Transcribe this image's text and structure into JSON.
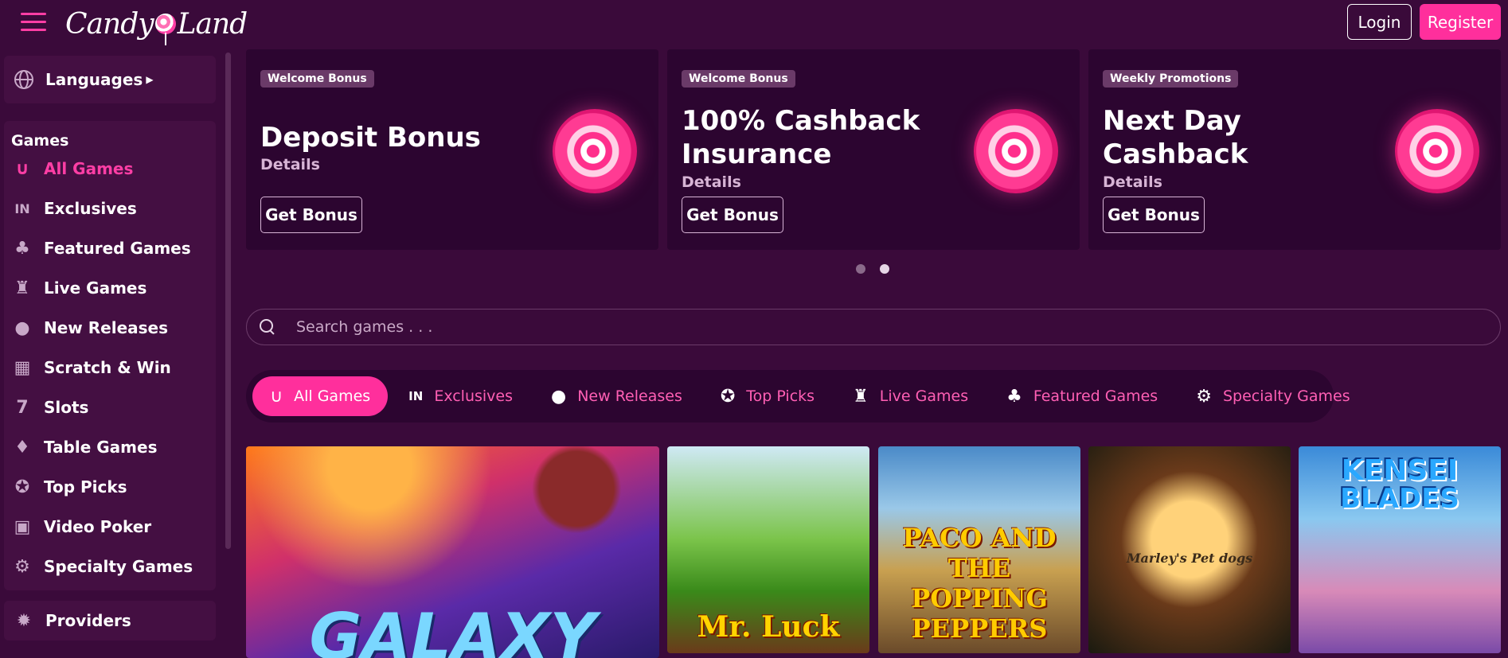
{
  "header": {
    "logo_text": "Candy Land",
    "logo_part1": "Candy",
    "logo_part2": "Land",
    "login_label": "Login",
    "register_label": "Register"
  },
  "sidebar": {
    "languages_label": "Languages",
    "games_title": "Games",
    "items": [
      {
        "label": "All Games",
        "icon": "horseshoe-icon",
        "active": true
      },
      {
        "label": "Exclusives",
        "icon": "exclusive-icon"
      },
      {
        "label": "Featured Games",
        "icon": "clover-icon"
      },
      {
        "label": "Live Games",
        "icon": "live-icon"
      },
      {
        "label": "New Releases",
        "icon": "cherries-icon"
      },
      {
        "label": "Scratch & Win",
        "icon": "ticket-icon"
      },
      {
        "label": "Slots",
        "icon": "seven-icon"
      },
      {
        "label": "Table Games",
        "icon": "cards-icon"
      },
      {
        "label": "Top Picks",
        "icon": "award-icon"
      },
      {
        "label": "Video Poker",
        "icon": "poker-icon"
      },
      {
        "label": "Specialty Games",
        "icon": "gear-icon"
      }
    ],
    "providers_label": "Providers"
  },
  "promos": [
    {
      "tag": "Welcome Bonus",
      "title": "Deposit Bonus",
      "details": "Details",
      "button": "Get Bonus"
    },
    {
      "tag": "Welcome Bonus",
      "title": "100% Cashback Insurance",
      "details": "Details",
      "button": "Get Bonus"
    },
    {
      "tag": "Weekly Promotions",
      "title": "Next Day Cashback",
      "details": "Details",
      "button": "Get Bonus"
    }
  ],
  "search": {
    "placeholder": "Search games . . ."
  },
  "tabs": [
    {
      "label": "All Games",
      "icon": "horseshoe-icon",
      "active": true
    },
    {
      "label": "Exclusives",
      "icon": "exclusive-icon"
    },
    {
      "label": "New Releases",
      "icon": "cherries-icon"
    },
    {
      "label": "Top Picks",
      "icon": "award-icon"
    },
    {
      "label": "Live Games",
      "icon": "live-icon"
    },
    {
      "label": "Featured Games",
      "icon": "clover-icon"
    },
    {
      "label": "Specialty Games",
      "icon": "gear-icon"
    }
  ],
  "games": [
    {
      "title": "GALAXY"
    },
    {
      "title": "Mr. Luck"
    },
    {
      "title": "PACO AND THE POPPING PEPPERS"
    },
    {
      "title": "Marley's Pet dogs"
    },
    {
      "title_line1": "KENSEI",
      "title_line2": "BLADES"
    }
  ],
  "colors": {
    "background": "#3a0a3a",
    "accent": "#ff2f9c",
    "card": "#2c0530"
  }
}
